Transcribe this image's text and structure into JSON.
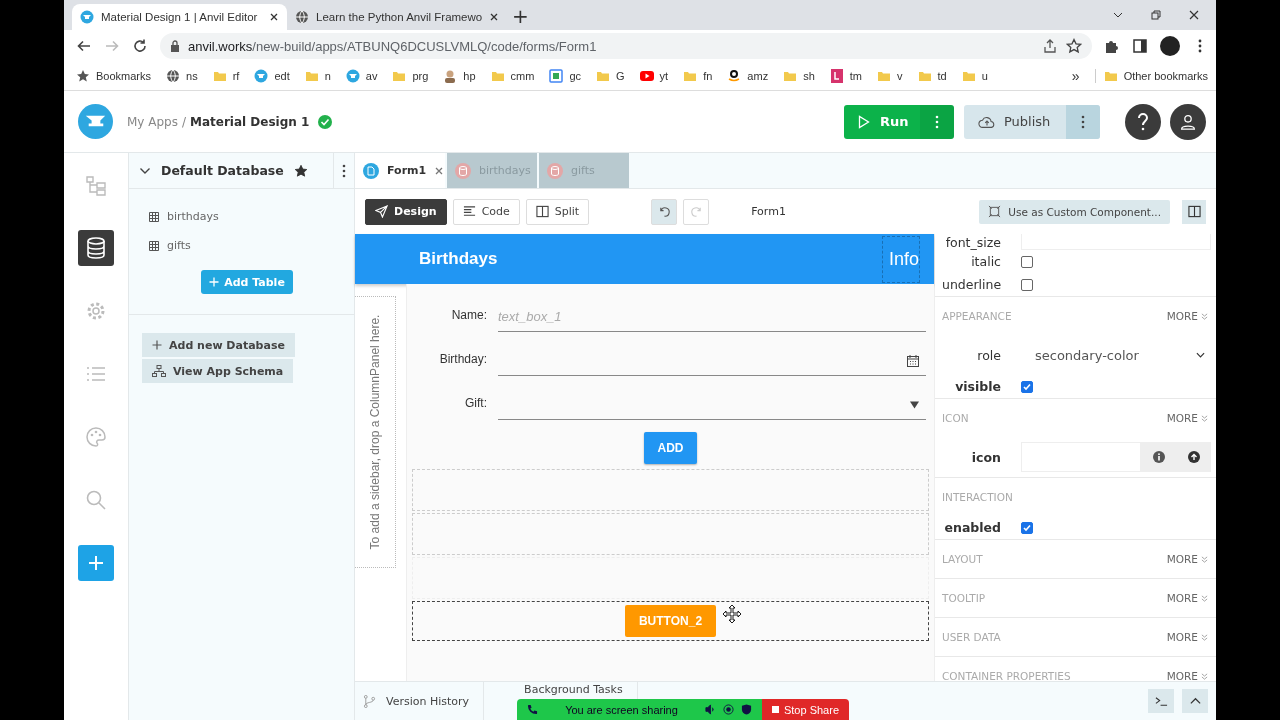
{
  "browser": {
    "tabs": [
      {
        "title": "Material Design 1 | Anvil Editor",
        "selected": true,
        "kind": "anvil"
      },
      {
        "title": "Learn the Python Anvil Framewo",
        "selected": false,
        "kind": "globe"
      }
    ],
    "new_tab": "+",
    "url_host": "anvil.works",
    "url_path": "/new-build/apps/ATBUNQ6DCUSLVMLQ/code/forms/Form1",
    "bookmarks": [
      {
        "label": "Bookmarks",
        "kind": "star"
      },
      {
        "label": "ns",
        "kind": "globe"
      },
      {
        "label": "rf",
        "kind": "folder"
      },
      {
        "label": "edt",
        "kind": "anvil"
      },
      {
        "label": "n",
        "kind": "folder"
      },
      {
        "label": "av",
        "kind": "anvil"
      },
      {
        "label": "prg",
        "kind": "folder"
      },
      {
        "label": "hp",
        "kind": "person"
      },
      {
        "label": "cmm",
        "kind": "folder"
      },
      {
        "label": "gc",
        "kind": "calendar"
      },
      {
        "label": "G",
        "kind": "folder"
      },
      {
        "label": "yt",
        "kind": "video"
      },
      {
        "label": "fn",
        "kind": "folder"
      },
      {
        "label": "amz",
        "kind": "amazon"
      },
      {
        "label": "sh",
        "kind": "folder"
      },
      {
        "label": "tm",
        "kind": "bookmark"
      },
      {
        "label": "v",
        "kind": "folder"
      },
      {
        "label": "td",
        "kind": "folder"
      },
      {
        "label": "u",
        "kind": "folder"
      }
    ],
    "more": "»",
    "other": "Other bookmarks"
  },
  "header": {
    "my_apps": "My Apps",
    "separator": "/",
    "app_name": "Material Design 1",
    "saved": true,
    "run": "Run",
    "publish": "Publish"
  },
  "rail": [
    {
      "kind": "tree",
      "selected": false
    },
    {
      "kind": "database",
      "selected": true
    },
    {
      "kind": "gear",
      "selected": false
    },
    {
      "kind": "list",
      "selected": false
    },
    {
      "kind": "palette",
      "selected": false
    },
    {
      "kind": "search",
      "selected": false
    }
  ],
  "database": {
    "title": "Default Database",
    "starred": true,
    "tables": [
      "birthdays",
      "gifts"
    ],
    "add_table": "Add Table",
    "actions": [
      {
        "label": "Add new Database",
        "kind": "plus"
      },
      {
        "label": "View App Schema",
        "kind": "schema"
      }
    ]
  },
  "editor_tabs": [
    {
      "label": "Form1",
      "kind": "form",
      "selected": true
    },
    {
      "label": "birthdays",
      "kind": "table",
      "selected": false
    },
    {
      "label": "gifts",
      "kind": "table",
      "selected": false
    }
  ],
  "modes": [
    {
      "label": "Design",
      "selected": true
    },
    {
      "label": "Code",
      "selected": false
    },
    {
      "label": "Split",
      "selected": false
    }
  ],
  "form_name": "Form1",
  "custom_component": "Use as Custom Component...",
  "form": {
    "title": "Birthdays",
    "info": "Info",
    "sidebar_hint": "To add a sidebar, drop a ColumnPanel here.",
    "fields": [
      {
        "label": "Name:",
        "kind": "text",
        "placeholder": "text_box_1"
      },
      {
        "label": "Birthday:",
        "kind": "date"
      },
      {
        "label": "Gift:",
        "kind": "dropdown"
      }
    ],
    "add_button": "ADD",
    "button_2": "BUTTON_2"
  },
  "properties": [
    {
      "kind": "text",
      "label": "font_size"
    },
    {
      "kind": "checkbox",
      "label": "italic",
      "checked": false,
      "bold": false
    },
    {
      "kind": "checkbox",
      "label": "underline",
      "checked": false,
      "bold": false
    },
    {
      "kind": "section",
      "label": "APPEARANCE",
      "more": "MORE"
    },
    {
      "kind": "select",
      "label": "role",
      "value": "secondary-color"
    },
    {
      "kind": "checkbox",
      "label": "visible",
      "checked": true,
      "bold": true
    },
    {
      "kind": "section",
      "label": "ICON",
      "more": "MORE"
    },
    {
      "kind": "icon",
      "label": "icon"
    },
    {
      "kind": "section",
      "label": "INTERACTION"
    },
    {
      "kind": "checkbox",
      "label": "enabled",
      "checked": true,
      "bold": true
    },
    {
      "kind": "section",
      "label": "LAYOUT",
      "more": "MORE"
    },
    {
      "kind": "section",
      "label": "TOOLTIP",
      "more": "MORE"
    },
    {
      "kind": "section",
      "label": "USER DATA",
      "more": "MORE"
    },
    {
      "kind": "section",
      "label": "CONTAINER PROPERTIES",
      "more": "MORE"
    }
  ],
  "footer": {
    "version_history": "Version History",
    "background_tasks": "Background Tasks",
    "sharing": "You are screen sharing",
    "stop_share": "Stop Share"
  }
}
